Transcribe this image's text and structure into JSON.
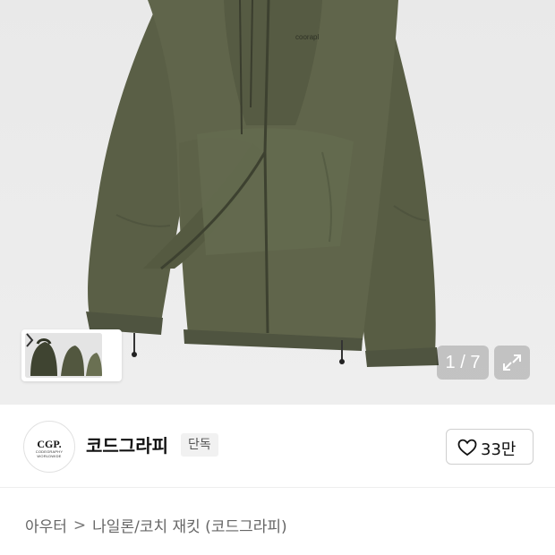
{
  "gallery": {
    "product_logo_text": "coorapl",
    "counter": "1 / 7",
    "icons": {
      "thumbnail_next": "chevron-right-icon",
      "expand": "expand-icon"
    },
    "colors": {
      "jacket": "#5c6148",
      "background": "#ececec"
    }
  },
  "brand": {
    "logo_line1": "CGP.",
    "logo_line2": "CODEGRAPHY WORLDWIDE",
    "name": "코드그라피",
    "badge": "단독",
    "likes": "33만",
    "icons": {
      "like": "heart-outline-icon"
    }
  },
  "breadcrumb": {
    "category": "아우터",
    "separator": ">",
    "subcategory": "나일론/코치 재킷 (코드그라피)"
  }
}
